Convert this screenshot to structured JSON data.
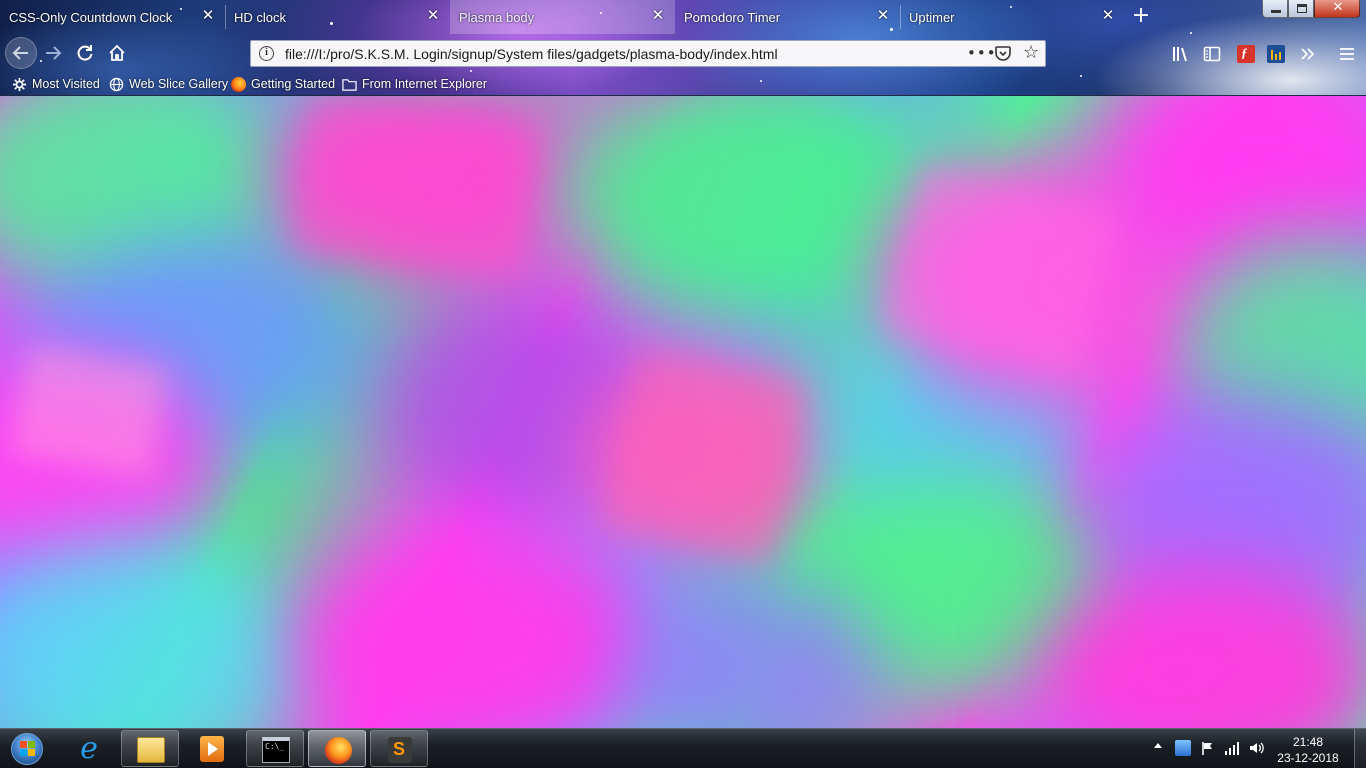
{
  "browser": {
    "tabs": [
      {
        "label": "CSS-Only Countdown Clock",
        "active": false
      },
      {
        "label": "HD clock",
        "active": false
      },
      {
        "label": "Plasma body",
        "active": true
      },
      {
        "label": "Pomodoro Timer",
        "active": false
      },
      {
        "label": "Uptimer",
        "active": false
      }
    ],
    "tab_close_glyph": "✕",
    "new_tab_glyph": "+",
    "url": "file:///I:/pro/S.K.S.M. Login/signup/System files/gadgets/plasma-body/index.html",
    "url_info_glyph": "i",
    "page_actions_glyph": "•••",
    "bookmark_star_glyph": "☆",
    "bookmarks": [
      {
        "label": "Most Visited",
        "icon": "gear-icon"
      },
      {
        "label": "Web Slice Gallery",
        "icon": "globe-icon"
      },
      {
        "label": "Getting Started",
        "icon": "firefox-icon"
      },
      {
        "label": "From Internet Explorer",
        "icon": "folder-icon"
      }
    ]
  },
  "page": {
    "name": "Plasma body",
    "colors": {
      "magenta": "#ff3cf2",
      "violet": "#8c8cff",
      "green": "#48f08c",
      "sky": "#58d8ff",
      "pink": "#ff5ab4"
    }
  },
  "taskbar": {
    "apps": [
      {
        "name": "Internet Explorer",
        "icon": "ie-icon",
        "state": "pinned"
      },
      {
        "name": "File Explorer",
        "icon": "folder-icon",
        "state": "running"
      },
      {
        "name": "Media Player",
        "icon": "media-player-icon",
        "state": "pinned"
      },
      {
        "name": "Command Prompt",
        "icon": "cmd-icon",
        "state": "running"
      },
      {
        "name": "Firefox",
        "icon": "firefox-icon",
        "state": "focused"
      },
      {
        "name": "Sublime Text",
        "icon": "sublime-icon",
        "state": "running"
      }
    ],
    "clock": {
      "time": "21:48",
      "date": "23-12-2018"
    }
  }
}
